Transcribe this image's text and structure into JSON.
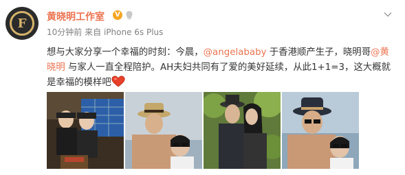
{
  "account": {
    "name": "黄晓明工作室",
    "avatar_letter": "F",
    "verified_icon": "v-badge-icon",
    "member_icon": "vip-icon"
  },
  "meta": {
    "time": "10分钟前",
    "source_prefix": "来自",
    "source": "iPhone 6s Plus"
  },
  "post": {
    "text_1": "想与大家分享一个幸福的时刻：今晨，",
    "mention_1": "@angelababy",
    "text_2": " 于香港顺产生子，晓明哥",
    "mention_2": "@黄晓明",
    "text_3": " 与家人一直全程陪护。AH夫妇共同有了爱的美好延续，从此1+1=3，这大概就是幸福的模样吧",
    "emoji": "heart-icon"
  },
  "photos": [
    "photo-1",
    "photo-2",
    "photo-3",
    "photo-4"
  ],
  "colors": {
    "accent": "#eb7350",
    "meta": "#808080",
    "avatar_bg": "#2b2b2b",
    "avatar_gold": "#d7b46a"
  }
}
